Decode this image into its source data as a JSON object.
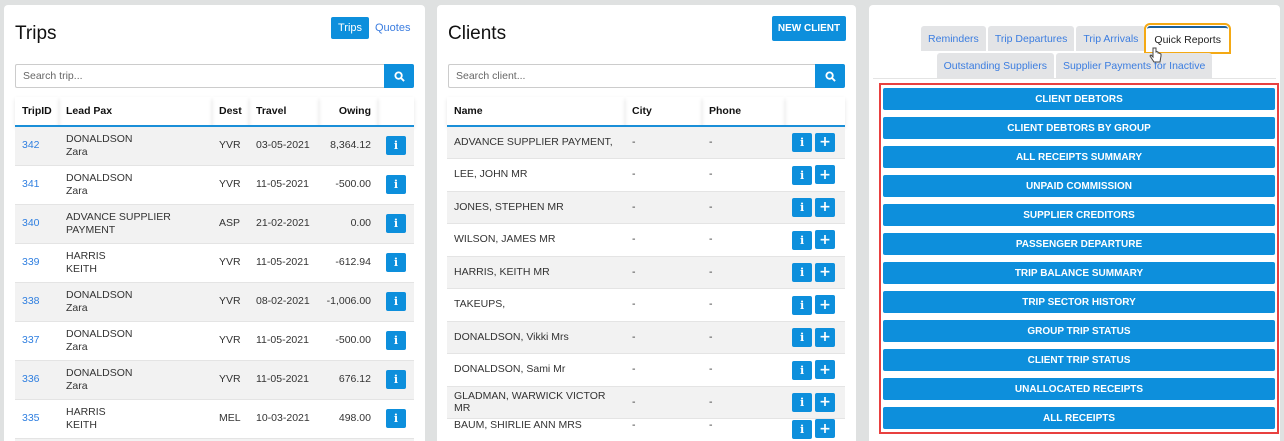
{
  "trips": {
    "title": "Trips",
    "toggle": [
      "Trips",
      "Quotes"
    ],
    "search_placeholder": "Search trip...",
    "columns": [
      "TripID",
      "Lead Pax",
      "Dest",
      "Travel",
      "Owing"
    ],
    "rows": [
      {
        "id": "342",
        "pax1": "DONALDSON",
        "pax2": "Zara",
        "dest": "YVR",
        "travel": "03-05-2021",
        "owing": "8,364.12"
      },
      {
        "id": "341",
        "pax1": "DONALDSON",
        "pax2": "Zara",
        "dest": "YVR",
        "travel": "11-05-2021",
        "owing": "-500.00"
      },
      {
        "id": "340",
        "pax1": "ADVANCE SUPPLIER PAYMENT",
        "pax2": "",
        "dest": "ASP",
        "travel": "21-02-2021",
        "owing": "0.00"
      },
      {
        "id": "339",
        "pax1": "HARRIS",
        "pax2": "KEITH",
        "dest": "YVR",
        "travel": "11-05-2021",
        "owing": "-612.94"
      },
      {
        "id": "338",
        "pax1": "DONALDSON",
        "pax2": "Zara",
        "dest": "YVR",
        "travel": "08-02-2021",
        "owing": "-1,006.00"
      },
      {
        "id": "337",
        "pax1": "DONALDSON",
        "pax2": "Zara",
        "dest": "YVR",
        "travel": "11-05-2021",
        "owing": "-500.00"
      },
      {
        "id": "336",
        "pax1": "DONALDSON",
        "pax2": "Zara",
        "dest": "YVR",
        "travel": "11-05-2021",
        "owing": "676.12"
      },
      {
        "id": "335",
        "pax1": "HARRIS",
        "pax2": "KEITH",
        "dest": "MEL",
        "travel": "10-03-2021",
        "owing": "498.00"
      },
      {
        "id": "",
        "pax1": "",
        "pax2": "",
        "dest": "",
        "travel": "",
        "owing": ""
      }
    ]
  },
  "clients": {
    "title": "Clients",
    "new_label": "NEW CLIENT",
    "search_placeholder": "Search client...",
    "columns": [
      "Name",
      "City",
      "Phone"
    ],
    "rows": [
      {
        "name": "ADVANCE SUPPLIER PAYMENT,",
        "city": "-",
        "phone": "-"
      },
      {
        "name": "LEE, JOHN MR",
        "city": "-",
        "phone": "-"
      },
      {
        "name": "JONES, STEPHEN MR",
        "city": "-",
        "phone": "-"
      },
      {
        "name": "WILSON, JAMES MR",
        "city": "-",
        "phone": "-"
      },
      {
        "name": "HARRIS, KEITH MR",
        "city": "-",
        "phone": "-"
      },
      {
        "name": "TAKEUPS,",
        "city": "-",
        "phone": "-"
      },
      {
        "name": "DONALDSON, Vikki Mrs",
        "city": "-",
        "phone": "-"
      },
      {
        "name": "DONALDSON, Sami Mr",
        "city": "-",
        "phone": "-"
      },
      {
        "name": "GLADMAN, WARWICK VICTOR MR",
        "city": "-",
        "phone": "-"
      },
      {
        "name": "BAUM, SHIRLIE ANN MRS",
        "city": "-",
        "phone": "-"
      }
    ]
  },
  "reports": {
    "tabs_row1": [
      "Reminders",
      "Trip Departures",
      "Trip Arrivals",
      "Quick Reports"
    ],
    "tabs_row2": [
      "Outstanding Suppliers",
      "Supplier Payments for Inactive"
    ],
    "buttons": [
      "CLIENT DEBTORS",
      "CLIENT DEBTORS BY GROUP",
      "ALL RECEIPTS SUMMARY",
      "UNPAID COMMISSION",
      "SUPPLIER CREDITORS",
      "PASSENGER DEPARTURE",
      "TRIP BALANCE SUMMARY",
      "TRIP SECTOR HISTORY",
      "GROUP TRIP STATUS",
      "CLIENT TRIP STATUS",
      "UNALLOCATED RECEIPTS",
      "ALL RECEIPTS"
    ]
  },
  "icons": {
    "search": "search-icon",
    "info": "i",
    "add": "+"
  }
}
